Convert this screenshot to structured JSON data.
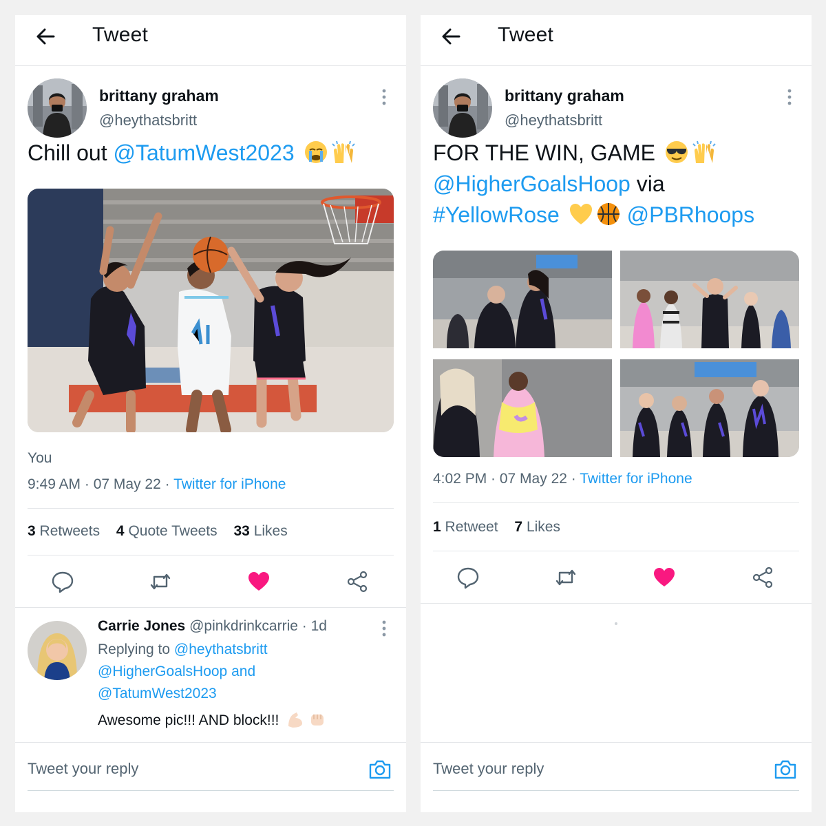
{
  "left": {
    "header_title": "Tweet",
    "author": {
      "name": "brittany graham",
      "handle": "@heythatsbritt"
    },
    "tweet": {
      "text_prefix": "Chill out ",
      "mention": "@TatumWest2023"
    },
    "you_label": "You",
    "time": "9:49 AM · 07 May 22 · ",
    "source": "Twitter for iPhone",
    "stats": [
      {
        "count": "3",
        "label": "Retweets"
      },
      {
        "count": "4",
        "label": "Quote Tweets"
      },
      {
        "count": "33",
        "label": "Likes"
      }
    ],
    "reply": {
      "name": "Carrie Jones",
      "handle": "@pinkdrinkcarrie · 1d",
      "replying_prefix": "Replying to ",
      "replying_to_1": "@heythatsbritt",
      "replying_to_2": "@HigherGoalsHoop",
      "replying_and": " and",
      "replying_to_3": "@TatumWest2023",
      "text": "Awesome pic!!! AND block!!!"
    },
    "compose_placeholder": "Tweet your reply"
  },
  "right": {
    "header_title": "Tweet",
    "author": {
      "name": "brittany graham",
      "handle": "@heythatsbritt"
    },
    "tweet": {
      "line1": "FOR THE WIN, GAME ",
      "mention1": "@HigherGoalsHoop",
      "via": " via",
      "hashtag": "#YellowRose",
      "mention2": "@PBRhoops"
    },
    "time": "4:02 PM · 07 May 22 · ",
    "source": "Twitter for iPhone",
    "stats": [
      {
        "count": "1",
        "label": "Retweet"
      },
      {
        "count": "7",
        "label": "Likes"
      }
    ],
    "compose_placeholder": "Tweet your reply"
  },
  "colors": {
    "link": "#1d9bf0",
    "like": "#f91880",
    "text_secondary": "#536471",
    "divider": "#e3e5e8"
  },
  "icons": [
    "back-arrow-icon",
    "more-vertical-icon",
    "reply-icon",
    "retweet-icon",
    "heart-icon",
    "share-icon",
    "camera-icon"
  ]
}
